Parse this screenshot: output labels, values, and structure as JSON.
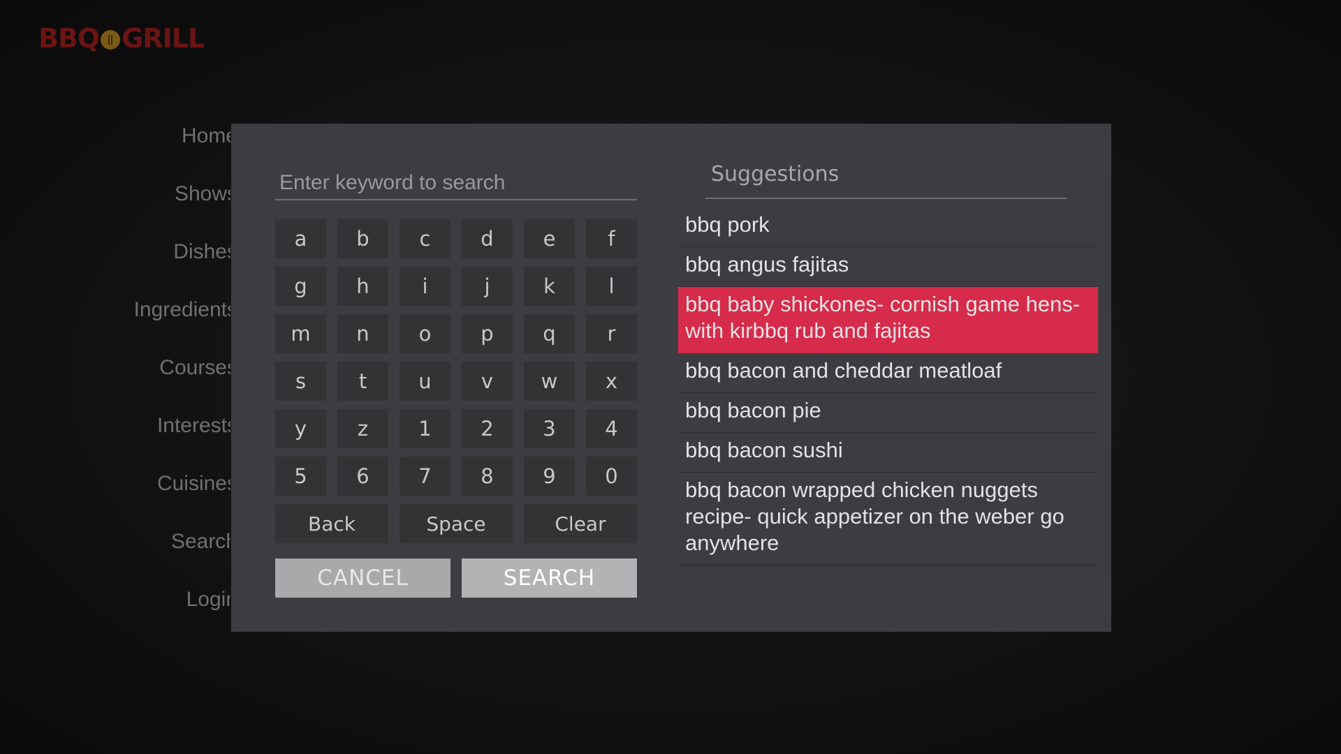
{
  "app": {
    "logo_text_left": "BBQ",
    "logo_text_right": "GRILL",
    "brand_color": "#6a1414"
  },
  "side_menu": {
    "items": [
      {
        "label": "Home"
      },
      {
        "label": "Shows"
      },
      {
        "label": "Dishes"
      },
      {
        "label": "Ingredients"
      },
      {
        "label": "Courses"
      },
      {
        "label": "Interests"
      },
      {
        "label": "Cuisines"
      },
      {
        "label": "Search"
      },
      {
        "label": "Login"
      }
    ]
  },
  "search_dialog": {
    "input": {
      "value": "",
      "placeholder": "Enter keyword to search"
    },
    "keys": [
      "a",
      "b",
      "c",
      "d",
      "e",
      "f",
      "g",
      "h",
      "i",
      "j",
      "k",
      "l",
      "m",
      "n",
      "o",
      "p",
      "q",
      "r",
      "s",
      "t",
      "u",
      "v",
      "w",
      "x",
      "y",
      "z",
      "1",
      "2",
      "3",
      "4",
      "5",
      "6",
      "7",
      "8",
      "9",
      "0"
    ],
    "special_keys": {
      "back": "Back",
      "space": "Space",
      "clear": "Clear"
    },
    "buttons": {
      "cancel": "CANCEL",
      "search": "SEARCH"
    },
    "suggestions": {
      "title": "Suggestions",
      "highlight_color": "#d62b4a",
      "items": [
        {
          "label": "bbq pork",
          "selected": false
        },
        {
          "label": "bbq angus fajitas",
          "selected": false
        },
        {
          "label": "bbq baby shickones- cornish game hens- with kirbbq rub and fajitas",
          "selected": true
        },
        {
          "label": "bbq bacon and cheddar meatloaf",
          "selected": false
        },
        {
          "label": "bbq bacon pie",
          "selected": false
        },
        {
          "label": "bbq bacon sushi",
          "selected": false
        },
        {
          "label": "bbq bacon wrapped chicken nuggets recipe- quick appetizer on the weber go anywhere",
          "selected": false
        }
      ]
    }
  }
}
